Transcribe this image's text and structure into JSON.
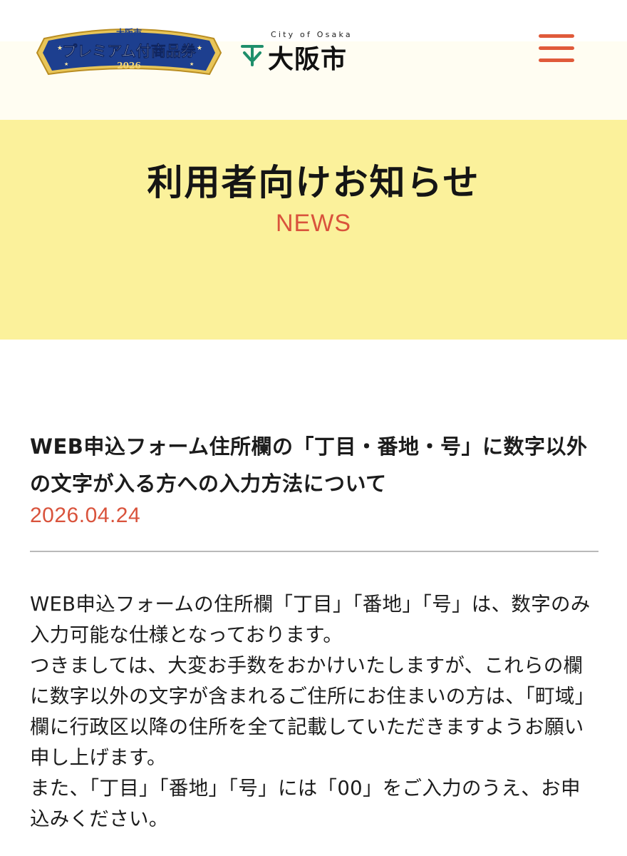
{
  "header": {
    "premium_logo": {
      "top_text": "大阪市",
      "main_text": "プレミアム付商品券",
      "year_text": "2026"
    },
    "city_logo": {
      "romaji": "City of Osaka",
      "name": "大阪市"
    },
    "menu_icon": "hamburger-menu-icon"
  },
  "hero": {
    "title": "利用者向けお知らせ",
    "subtitle": "NEWS"
  },
  "article": {
    "title": "WEB申込フォーム住所欄の「丁目・番地・号」に数字以外の文字が入る方への入力方法について",
    "date": "2026.04.24",
    "paragraphs": [
      "WEB申込フォームの住所欄「丁目」「番地」「号」は、数字のみ入力可能な仕様となっております。",
      "つきましては、大変お手数をおかけいたしますが、これらの欄に数字以外の文字が含まれるご住所にお住まいの方は、「町域」欄に行政区以降の住所を全て記載していただきますようお願い申し上げます。",
      "また、「丁目」「番地」「号」には「00」をご入力のうえ、お申込みください。"
    ]
  },
  "colors": {
    "accent": "#d9533c",
    "hero_background": "#fbf19b",
    "header_background": "#fffdf2",
    "logo_blue": "#1d3f8f",
    "logo_gold": "#e8c558",
    "city_mark_green": "#1f8f6b"
  }
}
